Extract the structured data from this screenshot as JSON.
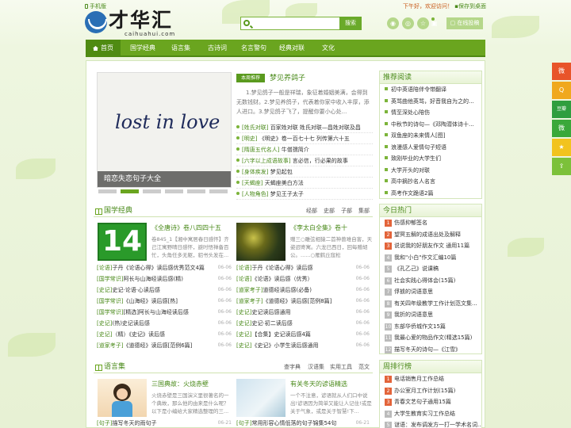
{
  "top": {
    "mobile_label": "手机版",
    "greeting": "下午好，欢迎访问！",
    "save_desktop": "保存到桌面"
  },
  "logo": {
    "cn": "才华汇",
    "en": "caihuahui.com"
  },
  "search": {
    "placeholder": "",
    "button": "搜索"
  },
  "social": {
    "online_submit": "在线投稿"
  },
  "nav": {
    "items": [
      "首页",
      "国学经典",
      "语言集",
      "古诗词",
      "名言警句",
      "经典对联",
      "文化"
    ]
  },
  "slider": {
    "caption": "暗恋失恋句子大全",
    "art_text": "lost in love"
  },
  "featured": {
    "badge": "本周推荐",
    "title": "梦见养鸽子",
    "desc": "1.梦见鸽子一般是祥瑞，象征着婚姻美满，会得到无数钱财。2.梦见养鸽子，代表着你家中收入丰厚，添人进口。3.梦见鸽子飞了，提醒你要小心处...",
    "list": [
      {
        "tag": "[姓氏对联]",
        "text": "百家姓对联 姓氏对联—昌姓对联及昌"
      },
      {
        "tag": "[明史]",
        "text": "《明史》卷一百七十七 列传第六十五"
      },
      {
        "tag": "[隋唐五代名人]",
        "text": "牛僧孺简介"
      },
      {
        "tag": "[六字以上成语故事]",
        "text": "言必信，行必果的故事"
      },
      {
        "tag": "[身体疾发]",
        "text": "梦见起包"
      },
      {
        "tag": "[天蝎座]",
        "text": "天蝎座美白方法"
      },
      {
        "tag": "[人物角色]",
        "text": "梦见王子太子"
      }
    ]
  },
  "guoxue": {
    "title": "国学经典",
    "links": [
      "经部",
      "史部",
      "子部",
      "集部"
    ],
    "card1": {
      "big": "14",
      "title": "《全唐诗》卷八四四十五",
      "desc": "卷845_1【湘中寓居春日感怀】齐己江寓野晴日感怀，避时悟禅备百忙，头角任多无躯，貂书头发在..."
    },
    "card2": {
      "title": "《李太白全集》卷十",
      "desc": "赠三○雕弦相猿二首神兽难自害，天姿迥寄寓。六龙已西日，回每赠胡公。......○雁鹤丘寇松"
    },
    "left": [
      {
        "tag": "[论语]",
        "text": "子丹《论语心得》读后感优秀范文4篇",
        "date": "06-06"
      },
      {
        "tag": "[国学常识]",
        "text": "阿长与山海经读后感(精)",
        "date": "06-06"
      },
      {
        "tag": "[史记]",
        "text": "史记·论语·心读后感",
        "date": "06-06"
      },
      {
        "tag": "[国学常识]",
        "text": "《山海经》读后感[热]",
        "date": "06-06"
      },
      {
        "tag": "[国学常识]",
        "text": "[精选]阿长与山海经读后感",
        "date": "06-06"
      },
      {
        "tag": "[史记]",
        "text": "(热)史记读后感",
        "date": "06-06"
      },
      {
        "tag": "[史记]",
        "text": "（精）《史记》读后感",
        "date": "06-06"
      },
      {
        "tag": "[道家考子]",
        "text": "《道德经》读后感[范例6篇]",
        "date": "06-06"
      }
    ],
    "right": [
      {
        "tag": "[论语]",
        "text": "于丹《论语心得》读后感",
        "date": "06-06"
      },
      {
        "tag": "[论语]",
        "text": "《论语》读后感（优秀）",
        "date": "06-06"
      },
      {
        "tag": "[道家考子]",
        "text": "道德经读后感(必备)",
        "date": "06-06"
      },
      {
        "tag": "[道家考子]",
        "text": "《道德经》读后感[范例8篇]",
        "date": "06-06"
      },
      {
        "tag": "[史记]",
        "text": "史记读后感通用",
        "date": "06-06"
      },
      {
        "tag": "[史记]",
        "text": "史记·初二读后感",
        "date": "06-06"
      },
      {
        "tag": "[史记]",
        "text": "【合集】史记读后感4篇",
        "date": "06-06"
      },
      {
        "tag": "[史记]",
        "text": "《史记》小学生读后感通用",
        "date": "06-06"
      }
    ]
  },
  "yuyan": {
    "title": "语言集",
    "links": [
      "查字典",
      "汉语集",
      "实用工具",
      "范文"
    ],
    "card1": {
      "title": "三国典故：火烧赤壁",
      "desc": "火烧赤壁是三国演义里很著名的一个典故，那么他的由来是什么呢？以下是小编给大家精选整理的三..."
    },
    "card2": {
      "title": "有关冬天的谚语精选",
      "desc": "一个不注意，谚语就从人们口中说出!谚语因为简单又能让人记住!或是关于气象，或是关于智慧!下..."
    },
    "left": [
      {
        "tag": "[句子]",
        "text": "描写冬天的雨句子",
        "date": "06-21"
      }
    ],
    "right": [
      {
        "tag": "[句子]",
        "text": "常用形容心情低落的句子锦集54句",
        "date": "06-21"
      }
    ]
  },
  "recommend": {
    "title": "推荐阅读",
    "items": [
      "初中英语陪伴令带翻译",
      "英骂曲他英骂，好音我自为之的...",
      "情至深处心陪伤",
      "中秋节的诗句—《邓陶潜体诗十...",
      "双鱼座的未来情人[图]",
      "浪漫感人爱情句子短语",
      "致刚毕业的大学生们",
      "大学开头的对联",
      "高中摘抄名人名言",
      "高考作文跪语2篇"
    ]
  },
  "hot": {
    "title": "今日热门",
    "items": [
      "伤感抑郁签名",
      "望冥五解的成语出处及解释",
      "说说我的好朋友作文 通用11篇",
      "我和\"小白\"作文汇编10篇",
      "《孔乙己》说课稿",
      "社会实践心得体会(15篇)",
      "俘掳的词语意思",
      "有关四年级教学工作计划范文集...",
      "我折的词语意思",
      "东部华侨城作文15篇",
      "我最心爱的物品作文(精选15篇)",
      "描写冬天的诗句—《江雪》"
    ]
  },
  "ranking": {
    "title": "周排行榜",
    "items": [
      "电话销售月工作总结",
      "办公室月工作计划(15篇)",
      "青春文艺句子通用15篇",
      "大学生教育实习工作总结",
      "谜语：发布调发方一打一学术名词..."
    ]
  },
  "rightbar": {
    "items": [
      {
        "icon": "weibo",
        "label": "微",
        "color": "#e8542a"
      },
      {
        "icon": "qzone",
        "label": "Q",
        "color": "#f0a81e"
      },
      {
        "icon": "douban",
        "label": "豆瓣",
        "color": "#2f9e3f"
      },
      {
        "icon": "wechat",
        "label": "微",
        "color": "#3aa83a"
      },
      {
        "icon": "star",
        "label": "★",
        "color": "#f2c31e"
      },
      {
        "icon": "share",
        "label": "⇪",
        "color": "#7cc13a"
      }
    ]
  }
}
